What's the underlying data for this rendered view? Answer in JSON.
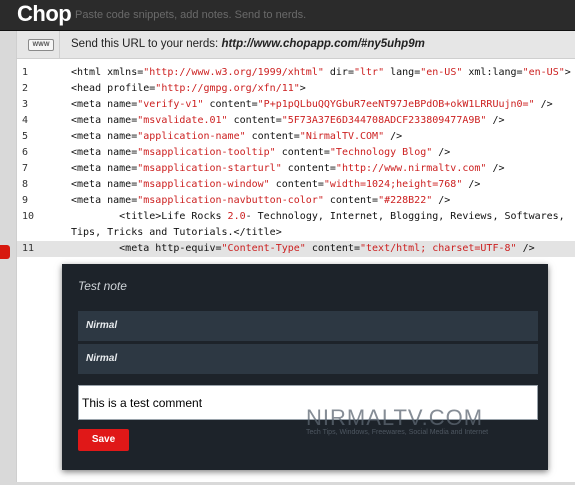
{
  "app": {
    "logo": "Chop",
    "tagline": "Paste code snippets, add notes. Send to nerds."
  },
  "urlbar": {
    "icon": "www-icon",
    "icon_label": "WWW",
    "prefix": "Send this URL to your nerds: ",
    "url": "http://www.chopapp.com/#ny5uhp9m"
  },
  "code": {
    "lines": [
      {
        "n": "1",
        "html": "&lt;html xmlns=<span class='s'>\"http://www.w3.org/1999/xhtml\"</span> dir=<span class='s'>\"ltr\"</span> lang=<span class='s'>\"en-US\"</span> xml:lang=<span class='s'>\"en-US\"</span>&gt;"
      },
      {
        "n": "2",
        "html": "&lt;head profile=<span class='s'>\"http://gmpg.org/xfn/11\"</span>&gt;"
      },
      {
        "n": "3",
        "html": "&lt;meta name=<span class='s'>\"verify-v1\"</span> content=<span class='s'>\"P+p1pQLbuQQYGbuR7eeNT97JeBPdOB+okW1LRRUujn0=\"</span> /&gt;"
      },
      {
        "n": "4",
        "html": "&lt;meta name=<span class='s'>\"msvalidate.01\"</span> content=<span class='s'>\"5F73A37E6D344708ADCF233809477A9B\"</span> /&gt;"
      },
      {
        "n": "5",
        "html": "&lt;meta name=<span class='s'>\"application-name\"</span> content=<span class='s'>\"NirmalTV.COM\"</span> /&gt;"
      },
      {
        "n": "6",
        "html": "&lt;meta name=<span class='s'>\"msapplication-tooltip\"</span> content=<span class='s'>\"Technology Blog\"</span> /&gt;"
      },
      {
        "n": "7",
        "html": "&lt;meta name=<span class='s'>\"msapplication-starturl\"</span> content=<span class='s'>\"http://www.nirmaltv.com\"</span> /&gt;"
      },
      {
        "n": "8",
        "html": "&lt;meta name=<span class='s'>\"msapplication-window\"</span> content=<span class='s'>\"width=1024;height=768\"</span> /&gt;"
      },
      {
        "n": "9",
        "html": "&lt;meta name=<span class='s'>\"msapplication-navbutton-color\"</span> content=<span class='s'>\"#228B22\"</span> /&gt;"
      },
      {
        "n": "10",
        "html": "        &lt;title&gt;Life Rocks <span class='s'>2.0</span>- Technology, Internet, Blogging, Reviews, Softwares,"
      },
      {
        "n": "",
        "html": "Tips, Tricks and Tutorials.&lt;/title&gt;"
      },
      {
        "n": "11",
        "html": "        &lt;meta http-equiv=<span class='s'>\"Content-Type\"</span> content=<span class='s'>\"text/html; charset=UTF-8\"</span> /&gt;"
      }
    ],
    "highlight_line": "11"
  },
  "note": {
    "title": "Test note",
    "comments": [
      "Nirmal",
      "Nirmal"
    ],
    "input_value": "This is a test comment",
    "save_label": "Save"
  },
  "watermark": {
    "title": "NIRMALTV.COM",
    "subtitle": "Tech Tips, Windows, Freewares, Social Media and Internet"
  },
  "colors": {
    "accent": "#e01818",
    "string": "#cc1f1f",
    "note_bg": "#1d232a",
    "comment_bg": "#2d3843"
  }
}
